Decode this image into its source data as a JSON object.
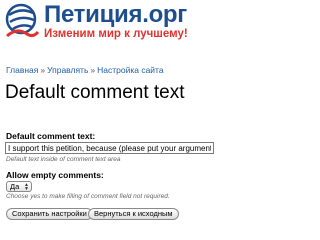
{
  "header": {
    "site_name": "Петиция.орг",
    "slogan": "Изменим мир к лучшему!",
    "logo_icon": "globe-logo-icon"
  },
  "breadcrumb": {
    "items": [
      "Главная",
      "Управлять",
      "Настройка сайта"
    ],
    "separator": "»"
  },
  "page": {
    "title": "Default comment text"
  },
  "form": {
    "comment_text": {
      "label": "Default comment text:",
      "value": "I support this petition, because (please put your arguments",
      "description": "Default text inside of comment text area"
    },
    "allow_empty": {
      "label": "Allow empty comments:",
      "selected": "Да",
      "description": "Choose yes to make filling of comment field not required."
    },
    "buttons": {
      "save": "Сохранить настройки",
      "reset": "Вернуться к исходным"
    }
  },
  "colors": {
    "brand_blue": "#1f4e8e",
    "slogan_red": "#e0332f",
    "link_blue": "#1f5fa8"
  }
}
